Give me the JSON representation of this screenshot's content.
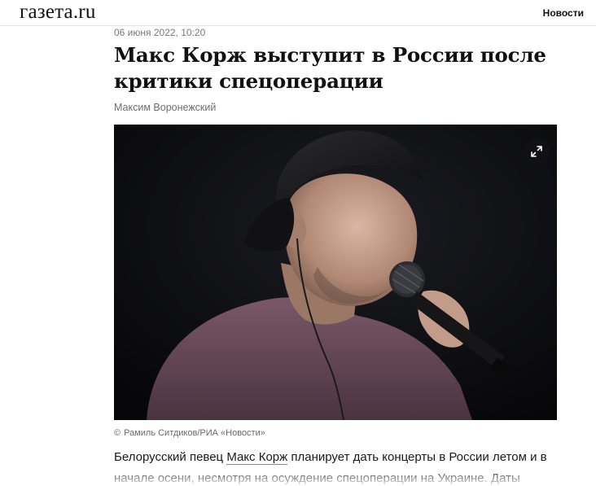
{
  "header": {
    "logo_text": "газета.ru",
    "nav_news_label": "Новости"
  },
  "article": {
    "date": "06 июня 2022, 10:20",
    "title": "Макс Корж выступит в России после критики спецоперации",
    "author": "Максим Воронежский",
    "photo_icon": "expand-icon",
    "credit_symbol": "©",
    "credit_text": "Рамиль Ситдиков/РИА «Новости»",
    "body_before_link": "Белорусский певец ",
    "body_link": "Макс Корж",
    "body_after_link": " планирует дать концерты в России летом и в начале осени, несмотря на осуждение спецоперации на Украине. Даты"
  },
  "colors": {
    "text": "#111111",
    "meta_gray": "#7a7a7a",
    "photo_background": "#0c0c0f",
    "shirt_mauve": "#6b4a5b"
  }
}
